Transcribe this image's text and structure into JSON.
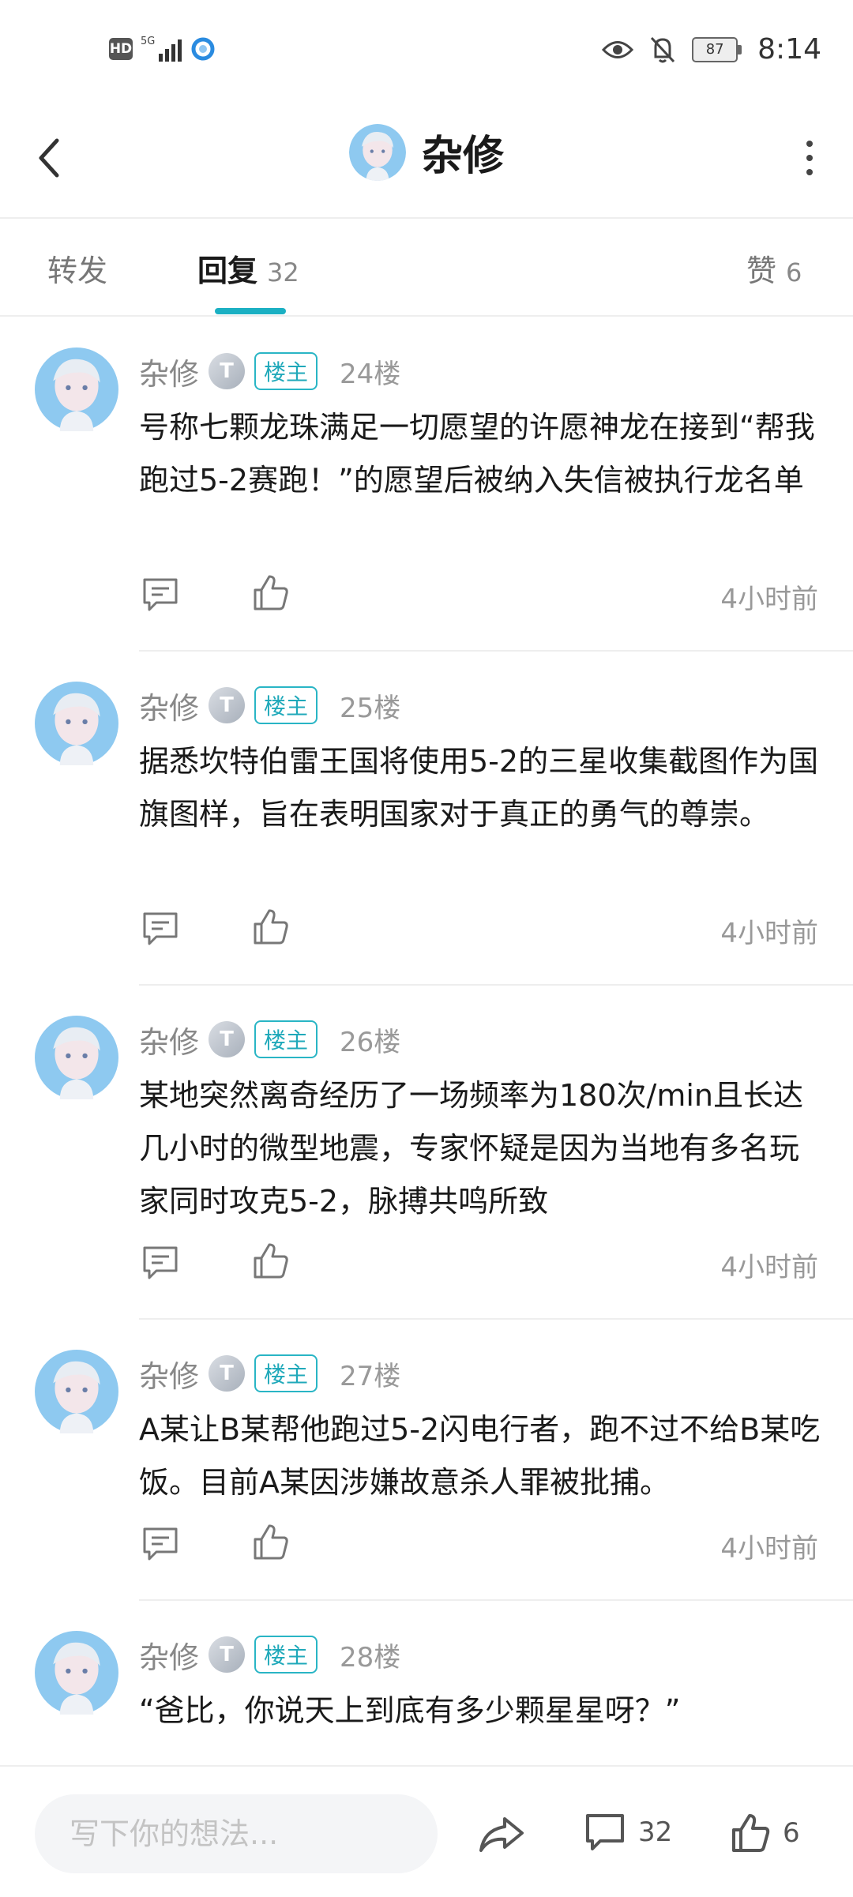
{
  "status_bar": {
    "time": "8:14",
    "battery": "87",
    "network": "5G"
  },
  "header": {
    "title": "杂修"
  },
  "tabs": [
    {
      "label": "转发",
      "count": ""
    },
    {
      "label": "回复",
      "count": "32"
    },
    {
      "label": "赞",
      "count": "6"
    }
  ],
  "posts": [
    {
      "author": "杂修",
      "badge": "楼主",
      "floor": "24楼",
      "content": "号称七颗龙珠满足一切愿望的许愿神龙在接到“帮我跑过5-2赛跑！”的愿望后被纳入失信被执行龙名单",
      "time": "4小时前"
    },
    {
      "author": "杂修",
      "badge": "楼主",
      "floor": "25楼",
      "content": "据悉坎特伯雷王国将使用5-2的三星收集截图作为国旗图样，旨在表明国家对于真正的勇气的尊崇。",
      "time": "4小时前"
    },
    {
      "author": "杂修",
      "badge": "楼主",
      "floor": "26楼",
      "content": "某地突然离奇经历了一场频率为180次/min且长达几小时的微型地震，专家怀疑是因为当地有多名玩家同时攻克5-2，脉搏共鸣所致",
      "time": "4小时前"
    },
    {
      "author": "杂修",
      "badge": "楼主",
      "floor": "27楼",
      "content": "A某让B某帮他跑过5-2闪电行者，跑不过不给B某吃饭。目前A某因涉嫌故意杀人罪被批捕。",
      "time": "4小时前"
    },
    {
      "author": "杂修",
      "badge": "楼主",
      "floor": "28楼",
      "content": "“爸比，你说天上到底有多少颗星星呀？”",
      "time": ""
    }
  ],
  "bottom_bar": {
    "input_placeholder": "写下你的想法...",
    "comment_count": "32",
    "like_count": "6"
  },
  "colors": {
    "accent": "#1bb0c3",
    "text": "#1a1a1a",
    "muted": "#999999"
  },
  "icons": [
    "back-icon",
    "more-icon",
    "comment-icon",
    "like-icon",
    "share-icon",
    "level-icon",
    "eye-icon",
    "bell-off-icon"
  ]
}
